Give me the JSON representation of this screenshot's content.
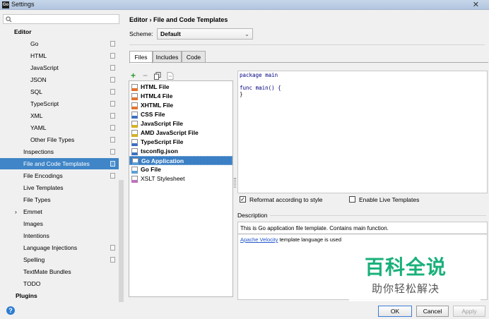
{
  "window": {
    "title": "Settings",
    "app_icon": "Go"
  },
  "search": {
    "placeholder": ""
  },
  "tree": [
    {
      "label": "Editor",
      "bold": true,
      "indent": 0,
      "sel": false,
      "copy": false,
      "arrow": false
    },
    {
      "label": "Go",
      "bold": false,
      "indent": 2,
      "sel": false,
      "copy": true,
      "arrow": false
    },
    {
      "label": "HTML",
      "bold": false,
      "indent": 2,
      "sel": false,
      "copy": true,
      "arrow": false
    },
    {
      "label": "JavaScript",
      "bold": false,
      "indent": 2,
      "sel": false,
      "copy": true,
      "arrow": false
    },
    {
      "label": "JSON",
      "bold": false,
      "indent": 2,
      "sel": false,
      "copy": true,
      "arrow": false
    },
    {
      "label": "SQL",
      "bold": false,
      "indent": 2,
      "sel": false,
      "copy": true,
      "arrow": false
    },
    {
      "label": "TypeScript",
      "bold": false,
      "indent": 2,
      "sel": false,
      "copy": true,
      "arrow": false
    },
    {
      "label": "XML",
      "bold": false,
      "indent": 2,
      "sel": false,
      "copy": true,
      "arrow": false
    },
    {
      "label": "YAML",
      "bold": false,
      "indent": 2,
      "sel": false,
      "copy": true,
      "arrow": false
    },
    {
      "label": "Other File Types",
      "bold": false,
      "indent": 2,
      "sel": false,
      "copy": true,
      "arrow": false
    },
    {
      "label": "Inspections",
      "bold": false,
      "indent": 1,
      "sel": false,
      "copy": true,
      "arrow": false
    },
    {
      "label": "File and Code Templates",
      "bold": false,
      "indent": 1,
      "sel": true,
      "copy": true,
      "arrow": false
    },
    {
      "label": "File Encodings",
      "bold": false,
      "indent": 1,
      "sel": false,
      "copy": true,
      "arrow": false
    },
    {
      "label": "Live Templates",
      "bold": false,
      "indent": 1,
      "sel": false,
      "copy": false,
      "arrow": false
    },
    {
      "label": "File Types",
      "bold": false,
      "indent": 1,
      "sel": false,
      "copy": false,
      "arrow": false
    },
    {
      "label": "Emmet",
      "bold": false,
      "indent": 1,
      "sel": false,
      "copy": false,
      "arrow": true
    },
    {
      "label": "Images",
      "bold": false,
      "indent": 1,
      "sel": false,
      "copy": false,
      "arrow": false
    },
    {
      "label": "Intentions",
      "bold": false,
      "indent": 1,
      "sel": false,
      "copy": false,
      "arrow": false
    },
    {
      "label": "Language Injections",
      "bold": false,
      "indent": 1,
      "sel": false,
      "copy": true,
      "arrow": false
    },
    {
      "label": "Spelling",
      "bold": false,
      "indent": 1,
      "sel": false,
      "copy": true,
      "arrow": false
    },
    {
      "label": "TextMate Bundles",
      "bold": false,
      "indent": 1,
      "sel": false,
      "copy": false,
      "arrow": false
    },
    {
      "label": "TODO",
      "bold": false,
      "indent": 1,
      "sel": false,
      "copy": false,
      "arrow": false
    },
    {
      "label": "Plugins",
      "bold": true,
      "indent": 0,
      "sel": false,
      "copy": false,
      "arrow": false
    }
  ],
  "breadcrumb": {
    "parent": "Editor",
    "sep": "›",
    "current": "File and Code Templates"
  },
  "scheme": {
    "label": "Scheme:",
    "value": "Default"
  },
  "tabs": [
    "Files",
    "Includes",
    "Code"
  ],
  "toolbar": {
    "add": "+",
    "remove": "−"
  },
  "files": [
    {
      "label": "HTML File",
      "badge": "HTML",
      "color": "#e8722c",
      "bold": true,
      "sel": false
    },
    {
      "label": "HTML4 File",
      "badge": "HTML",
      "color": "#e8722c",
      "bold": true,
      "sel": false
    },
    {
      "label": "XHTML File",
      "badge": "XH",
      "color": "#e8722c",
      "bold": true,
      "sel": false
    },
    {
      "label": "CSS File",
      "badge": "CSS",
      "color": "#3a6fc4",
      "bold": true,
      "sel": false
    },
    {
      "label": "JavaScript File",
      "badge": "JS",
      "color": "#d8b222",
      "bold": true,
      "sel": false
    },
    {
      "label": "AMD JavaScript File",
      "badge": "JS",
      "color": "#d8b222",
      "bold": true,
      "sel": false
    },
    {
      "label": "TypeScript File",
      "badge": "TS",
      "color": "#3a6fc4",
      "bold": true,
      "sel": false
    },
    {
      "label": "tsconfig.json",
      "badge": "{}",
      "color": "#3a6fc4",
      "bold": true,
      "sel": false
    },
    {
      "label": "Go Application",
      "badge": "GO",
      "color": "#5aa0d8",
      "bold": true,
      "sel": true
    },
    {
      "label": "Go File",
      "badge": "GO",
      "color": "#5aa0d8",
      "bold": true,
      "sel": false
    },
    {
      "label": "XSLT Stylesheet",
      "badge": "XSL",
      "color": "#c070c0",
      "bold": false,
      "sel": false
    }
  ],
  "editor": {
    "lines": [
      "package main",
      "",
      "func main() {",
      "}"
    ]
  },
  "options": {
    "reformat": "Reformat according to style",
    "reformat_checked": true,
    "live": "Enable Live Templates",
    "live_checked": false
  },
  "description": {
    "title": "Description",
    "line1": "This is Go application file template. Contains main function.",
    "link": "Apache Velocity",
    "line2_rest": " template language is used"
  },
  "watermark": {
    "main": "百科全说",
    "sub": "助你轻松解决"
  },
  "footer": {
    "help": "?",
    "ok": "OK",
    "cancel": "Cancel",
    "apply": "Apply"
  },
  "colors": {
    "selection": "#3f85c7",
    "accent": "#19b07a"
  }
}
